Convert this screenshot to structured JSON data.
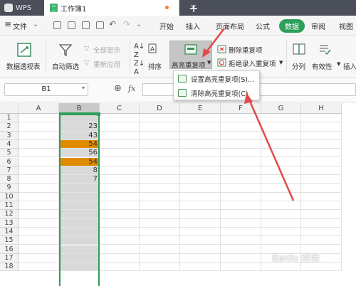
{
  "titlebar": {
    "app_tab": "WPS",
    "doc_tab": "工作簿1",
    "close_glyph": "✕",
    "new_tab_glyph": "+"
  },
  "menubar": {
    "file": "文件",
    "items": [
      "开始",
      "插入",
      "页面布局",
      "公式",
      "数据",
      "审阅",
      "视图"
    ]
  },
  "ribbon": {
    "pivot": "数据透视表",
    "autofilter": "自动筛选",
    "show_all": "全部显示",
    "reapply": "重新应用",
    "sort": "排序",
    "highlight_dup": "高亮重复项",
    "delete_dup": "删除重复项",
    "reject_dup": "拒绝录入重复项",
    "split": "分列",
    "validity": "有效性",
    "insert": "插入"
  },
  "formula_bar": {
    "cell_ref": "B1",
    "fx": "fx"
  },
  "dropdown": {
    "set_highlight": "设置高亮重复项(S)...",
    "clear_highlight": "清除高亮重复项(C)"
  },
  "sheet": {
    "columns": [
      "A",
      "B",
      "C",
      "D",
      "E",
      "F",
      "G",
      "H"
    ],
    "rows": [
      "1",
      "2",
      "3",
      "4",
      "5",
      "6",
      "7",
      "8",
      "9",
      "10",
      "11",
      "12",
      "13",
      "14",
      "15",
      "16",
      "17",
      "18"
    ],
    "column_b_values": [
      "",
      "23",
      "43",
      "54",
      "56",
      "54",
      "8",
      "7"
    ],
    "highlighted_rows": [
      4,
      6
    ]
  },
  "colors": {
    "accent_green": "#2e9e5b",
    "duplicate_fill": "#e08a00",
    "selection_fill": "#d9d9d9",
    "selection_border": "#2e9e5b",
    "arrow_red": "#e04a4a"
  },
  "watermark": "Baidu 经验"
}
